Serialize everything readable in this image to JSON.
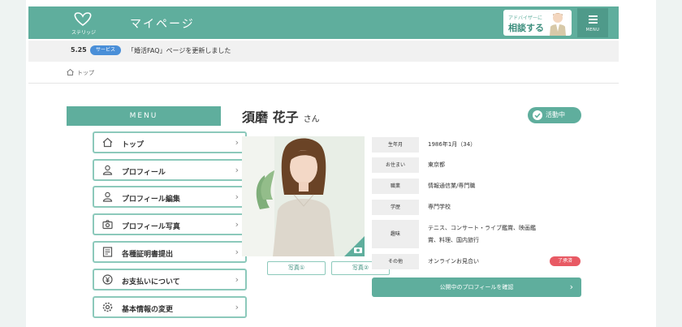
{
  "header": {
    "logo_text": "ステリッジ",
    "title": "マイページ",
    "consult_small": "アドバイザーに",
    "consult_main": "相談する",
    "menu_label": "MENU"
  },
  "news": {
    "date": "5.25",
    "badge": "サービス",
    "text": "「婚活FAQ」ページを更新しました"
  },
  "breadcrumb": {
    "home": "トップ"
  },
  "sidebar": {
    "title": "MENU",
    "items": [
      {
        "label": "トップ",
        "icon": "home-icon"
      },
      {
        "label": "プロフィール",
        "icon": "person-icon"
      },
      {
        "label": "プロフィール編集",
        "icon": "person-icon"
      },
      {
        "label": "プロフィール写真",
        "icon": "camera-icon"
      },
      {
        "label": "各種証明書提出",
        "icon": "document-icon"
      },
      {
        "label": "お支払いについて",
        "icon": "yen-icon"
      },
      {
        "label": "基本情報の変更",
        "icon": "gear-icon"
      }
    ]
  },
  "profile": {
    "name": "須磨 花子",
    "honorific": "さん",
    "status": "活動中",
    "photo_tabs": [
      "写真①",
      "写真②"
    ],
    "info": [
      {
        "key": "生年月",
        "value": "1986年1月（34）"
      },
      {
        "key": "お住まい",
        "value": "東京都"
      },
      {
        "key": "職業",
        "value": "情報通信業/専門職"
      },
      {
        "key": "学歴",
        "value": "専門学校"
      },
      {
        "key": "趣味",
        "value": "テニス、コンサート・ライブ鑑賞、映画鑑",
        "value2": "賞、料理、国内旅行"
      },
      {
        "key": "その他",
        "value": "オンラインお見合い"
      }
    ],
    "other_badge": "了承済",
    "cta": "公開中のプロフィールを確認"
  },
  "colors": {
    "brand": "#5fae9d",
    "brand_border": "#8cc9bb",
    "news_badge": "#4a8fd8",
    "alert": "#e85a64"
  }
}
